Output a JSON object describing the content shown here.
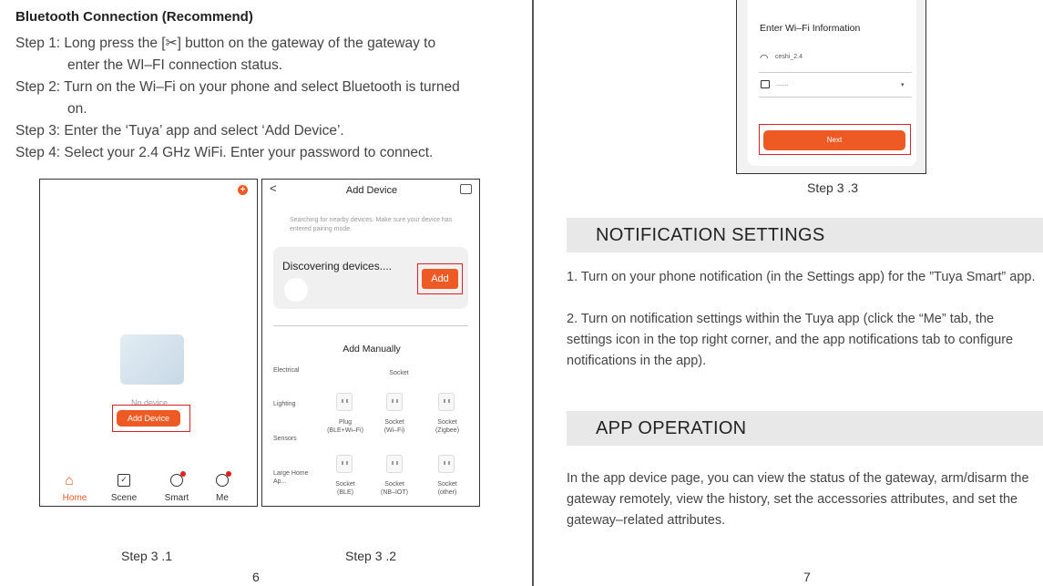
{
  "left": {
    "heading": "Bluetooth Connection (Recommend)",
    "steps": [
      {
        "line1": "Step 1: Long press the [✂] button on the gateway of the gateway to",
        "line2": "enter the WI–FI connection status."
      },
      {
        "line1": "Step 2: Turn on the Wi–Fi on your phone and select Bluetooth is turned",
        "line2": "on."
      },
      {
        "line1": "Step 3: Enter the ‘Tuya’ app and select ‘Add Device’.",
        "line2": ""
      },
      {
        "line1": "Step 4: Select your 2.4 GHz WiFi. Enter your password to connect.",
        "line2": ""
      }
    ],
    "phone1": {
      "no_device": "No device",
      "add_button": "Add Device",
      "nav": [
        "Home",
        "Scene",
        "Smart",
        "Me"
      ],
      "caption": "Step 3 .1"
    },
    "phone2": {
      "title": "Add Device",
      "hint": "Searching for nearby devices. Make sure your device has entered pairing mode.",
      "discovering": "Discovering devices....",
      "add": "Add",
      "manual": "Add Manually",
      "categories": [
        "Electrical",
        "Lighting",
        "Sensors",
        "Large Home Ap..."
      ],
      "socket_header": "Socket",
      "devices": [
        {
          "name": "Plug",
          "sub": "(BLE+Wi–Fi)"
        },
        {
          "name": "Socket",
          "sub": "(Wi–Fi)"
        },
        {
          "name": "Socket",
          "sub": "(Zigbee)"
        },
        {
          "name": "Socket",
          "sub": "(BLE)"
        },
        {
          "name": "Socket",
          "sub": "(NB–IOT)"
        },
        {
          "name": "Socket",
          "sub": "(other)"
        }
      ],
      "caption": "Step 3 .2"
    },
    "page_number": "6"
  },
  "right": {
    "phone3": {
      "title": "Enter Wi–Fi Information",
      "ssid": "ceshi_2.4",
      "password": ".......",
      "next": "Next",
      "caption": "Step 3 .3"
    },
    "notification": {
      "heading": "NOTIFICATION SETTINGS",
      "p1": "1. Turn on your phone notification (in the Settings app) for the ”Tuya Smart” app.",
      "p2": "2. Turn on notification settings within the Tuya app (click the “Me” tab, the settings icon in the top right corner, and the app notifications tab to configure notifications in the app)."
    },
    "operation": {
      "heading": "APP OPERATION",
      "p1": "In the app device page, you can view the status of the gateway, arm/disarm the gateway remotely, view the history, set the accessories attributes, and set the gateway–related attributes."
    },
    "page_number": "7"
  },
  "colors": {
    "accent": "#ee5a24",
    "highlight": "#e02020",
    "section_bg": "#e8e8e8"
  }
}
